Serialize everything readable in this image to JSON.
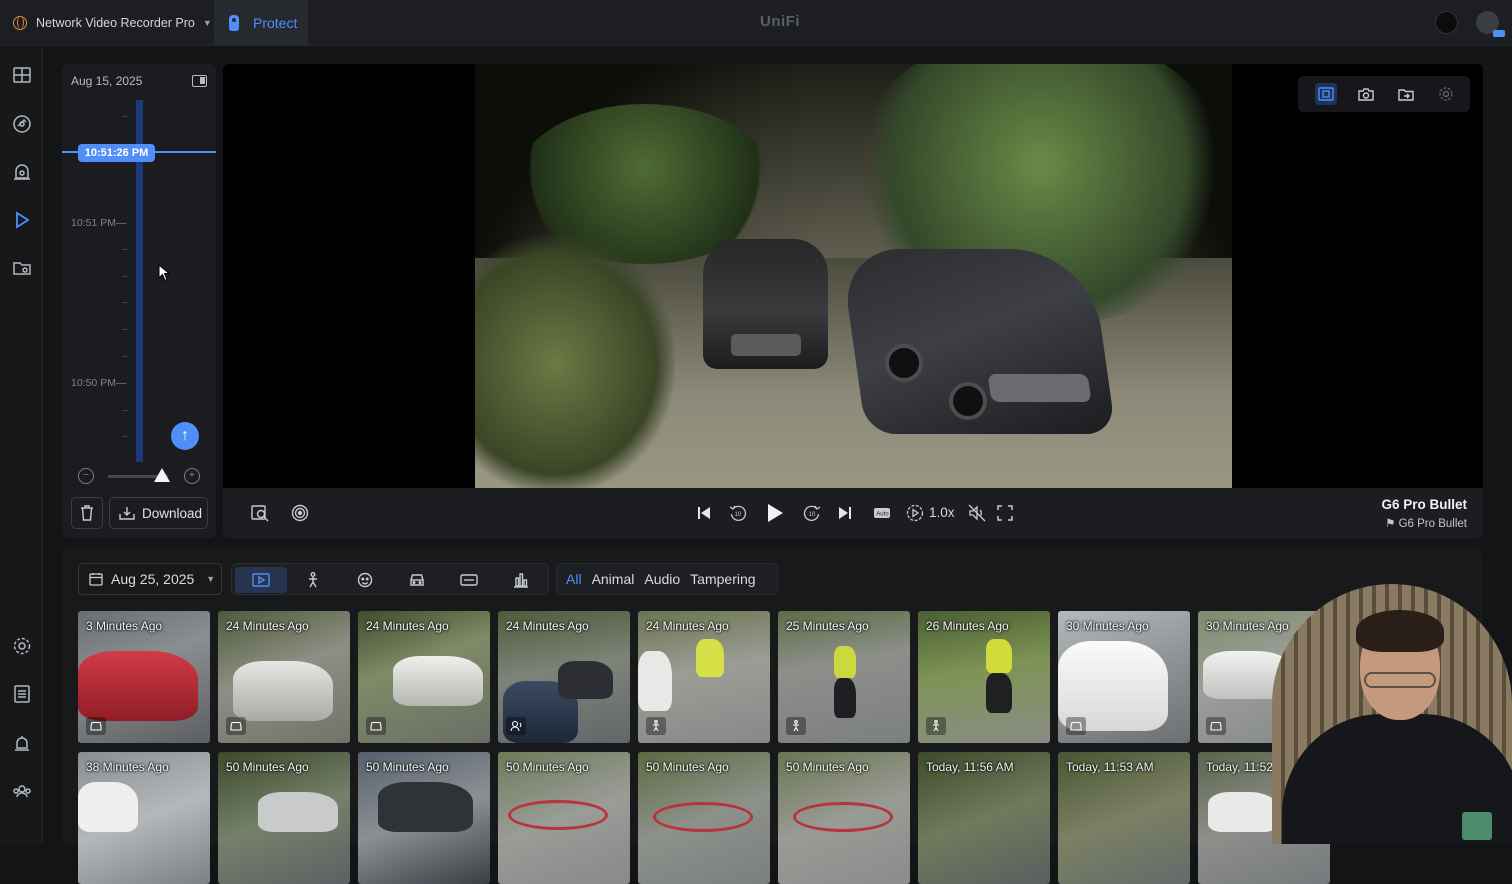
{
  "header": {
    "console_name": "Network Video Recorder Pro",
    "app_tab": "Protect",
    "brand": "UniFi"
  },
  "sidenav": {
    "items": [
      "dashboard-icon",
      "map-icon",
      "alarm-icon",
      "playback-icon",
      "files-icon",
      "settings-icon",
      "logs-icon",
      "notifications-icon",
      "users-icon"
    ],
    "active": "playback-icon"
  },
  "timeline": {
    "date": "Aug 15, 2025",
    "current_time": "10:51:26 PM",
    "labels": [
      "10:51 PM—",
      "10:50 PM—"
    ],
    "zoom_level": 0.9,
    "download_label": "Download"
  },
  "player": {
    "speed": "1.0x",
    "camera_name": "G6 Pro Bullet",
    "camera_model": "G6 Pro Bullet"
  },
  "events": {
    "date": "Aug 25, 2025",
    "type_filters": [
      "All",
      "Animal",
      "Audio",
      "Tampering"
    ],
    "active_type": "All",
    "thumbnails_row1": [
      {
        "label": "3 Minutes Ago",
        "icon": "vehicle-icon"
      },
      {
        "label": "24 Minutes Ago",
        "icon": "vehicle-icon"
      },
      {
        "label": "24 Minutes Ago",
        "icon": "vehicle-icon"
      },
      {
        "label": "24 Minutes Ago",
        "icon": "audio-icon"
      },
      {
        "label": "24 Minutes Ago",
        "icon": "person-icon"
      },
      {
        "label": "25 Minutes Ago",
        "icon": "person-icon"
      },
      {
        "label": "26 Minutes Ago",
        "icon": "person-icon"
      },
      {
        "label": "30 Minutes Ago",
        "icon": "vehicle-icon"
      },
      {
        "label": "30 Minutes Ago",
        "icon": "vehicle-icon"
      }
    ],
    "thumbnails_row2": [
      {
        "label": "38 Minutes Ago"
      },
      {
        "label": "50 Minutes Ago"
      },
      {
        "label": "50 Minutes Ago"
      },
      {
        "label": "50 Minutes Ago"
      },
      {
        "label": "50 Minutes Ago"
      },
      {
        "label": "50 Minutes Ago"
      },
      {
        "label": "Today, 11:56 AM"
      },
      {
        "label": "Today, 11:53 AM"
      },
      {
        "label": "Today, 11:52 AM"
      }
    ]
  },
  "colors": {
    "accent": "#4f8ff7",
    "background": "#121416",
    "panel": "#1a1c1f"
  }
}
